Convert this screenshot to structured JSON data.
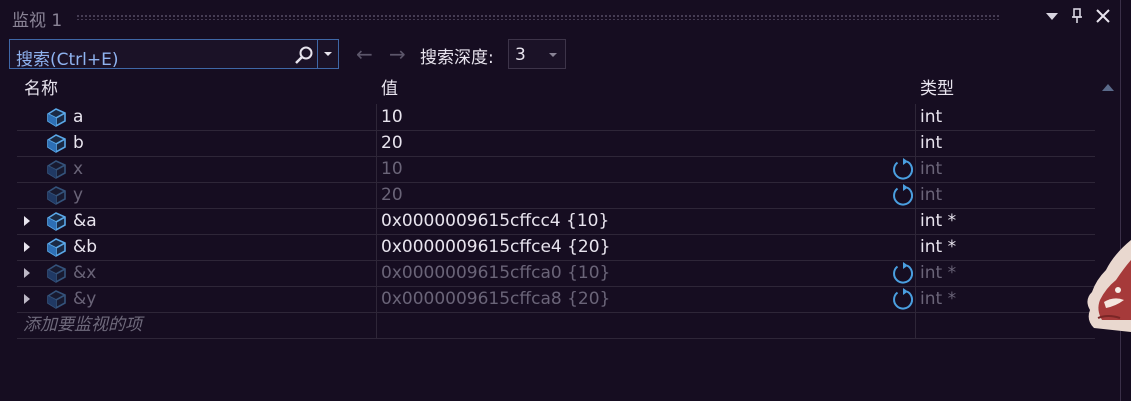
{
  "window": {
    "title": "监视 1",
    "dropdown_icon": "window-menu-icon",
    "pin_icon": "pin-icon",
    "close_icon": "close-icon"
  },
  "toolbar": {
    "search_text": "搜索(Ctrl+E)",
    "back_arrow": "←",
    "forward_arrow": "→",
    "depth_label": "搜索深度:",
    "depth_value": "3"
  },
  "columns": {
    "name": "名称",
    "value": "值",
    "type": "类型"
  },
  "rows": [
    {
      "name": "a",
      "value": "10",
      "type": "int",
      "expandable": false,
      "stale": false
    },
    {
      "name": "b",
      "value": "20",
      "type": "int",
      "expandable": false,
      "stale": false
    },
    {
      "name": "x",
      "value": "10",
      "type": "int",
      "expandable": false,
      "stale": true
    },
    {
      "name": "y",
      "value": "20",
      "type": "int",
      "expandable": false,
      "stale": true
    },
    {
      "name": "&a",
      "value": "0x0000009615cffcc4 {10}",
      "type": "int *",
      "expandable": true,
      "stale": false
    },
    {
      "name": "&b",
      "value": "0x0000009615cffce4 {20}",
      "type": "int *",
      "expandable": true,
      "stale": false
    },
    {
      "name": "&x",
      "value": "0x0000009615cffca0 {10}",
      "type": "int *",
      "expandable": true,
      "stale": true
    },
    {
      "name": "&y",
      "value": "0x0000009615cffca8 {20}",
      "type": "int *",
      "expandable": true,
      "stale": true
    }
  ],
  "add_item_placeholder": "添加要监视的项",
  "colors": {
    "accent": "#4a9fe0",
    "background": "#160d21",
    "stale_text": "#6a6478"
  }
}
